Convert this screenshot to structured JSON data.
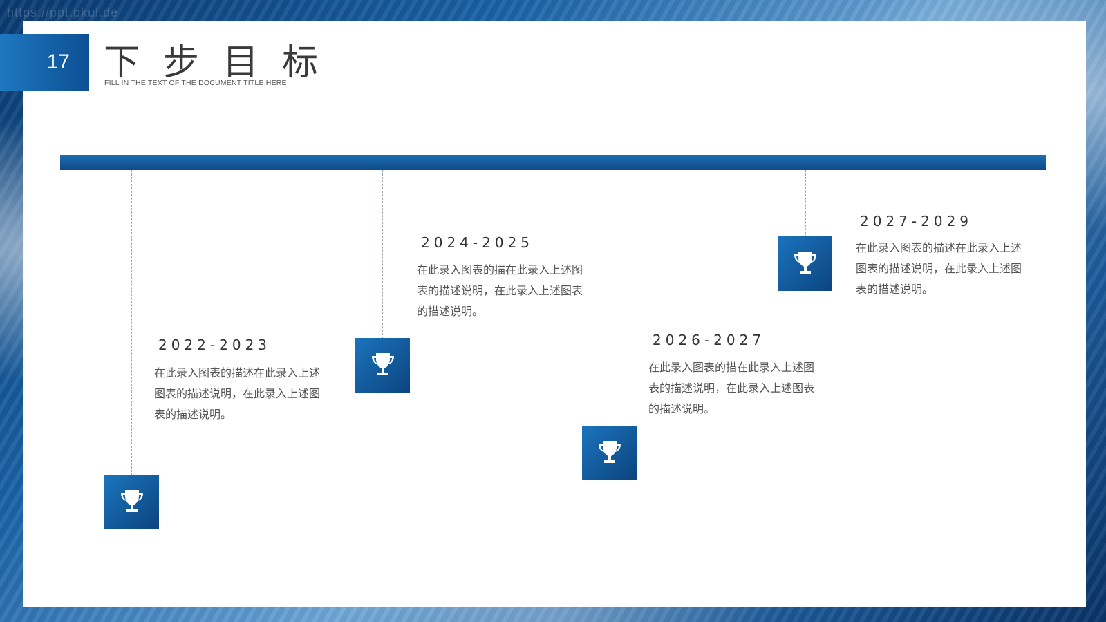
{
  "watermark": "https://ppt.pkul.de",
  "slide": {
    "number": "17",
    "title": "下步目标",
    "subtitle": "FILL IN THE TEXT OF THE DOCUMENT TITLE HERE"
  },
  "milestones": [
    {
      "year": "2022-2023",
      "text": "在此录入图表的描述在此录入上述图表的描述说明，在此录入上述图表的描述说明。",
      "icon": "trophy-icon"
    },
    {
      "year": "2024-2025",
      "text": "在此录入图表的描在此录入上述图表的描述说明，在此录入上述图表的描述说明。",
      "icon": "trophy-icon"
    },
    {
      "year": "2026-2027",
      "text": "在此录入图表的描在此录入上述图表的描述说明，在此录入上述图表的描述说明。",
      "icon": "trophy-icon"
    },
    {
      "year": "2027-2029",
      "text": "在此录入图表的描述在此录入上述图表的描述说明，在此录入上述图表的描述说明。",
      "icon": "trophy-icon"
    }
  ],
  "colors": {
    "accent": "#1566ab",
    "accent_dark": "#0c447f",
    "text": "#333333"
  }
}
